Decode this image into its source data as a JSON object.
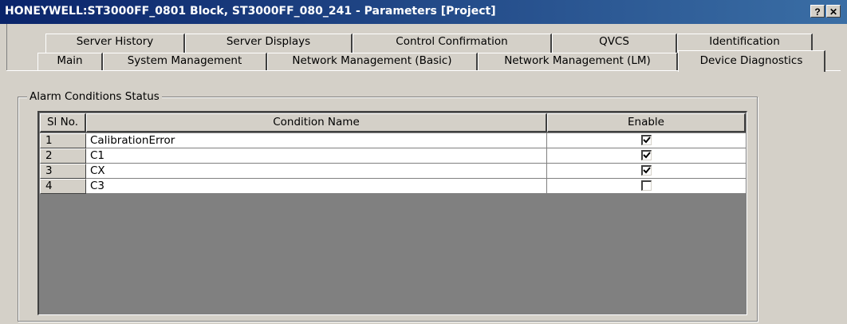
{
  "window": {
    "title": "HONEYWELL:ST3000FF_0801 Block, ST3000FF_080_241 - Parameters [Project]",
    "help_label": "?",
    "close_label": "✕"
  },
  "tabs_back": [
    {
      "label": "Server History"
    },
    {
      "label": "Server Displays"
    },
    {
      "label": "Control Confirmation"
    },
    {
      "label": "QVCS"
    },
    {
      "label": "Identification"
    }
  ],
  "tabs_front": [
    {
      "label": "Main"
    },
    {
      "label": "System Management"
    },
    {
      "label": "Network Management (Basic)"
    },
    {
      "label": "Network Management (LM)"
    },
    {
      "label": "Device Diagnostics",
      "active": true
    }
  ],
  "group": {
    "label": "Alarm Conditions Status"
  },
  "table": {
    "columns": [
      "Sl No.",
      "Condition Name",
      "Enable"
    ],
    "rows": [
      {
        "no": "1",
        "name": "CalibrationError",
        "enabled": true
      },
      {
        "no": "2",
        "name": "C1",
        "enabled": true
      },
      {
        "no": "3",
        "name": "CX",
        "enabled": true
      },
      {
        "no": "4",
        "name": "C3",
        "enabled": false
      }
    ]
  }
}
